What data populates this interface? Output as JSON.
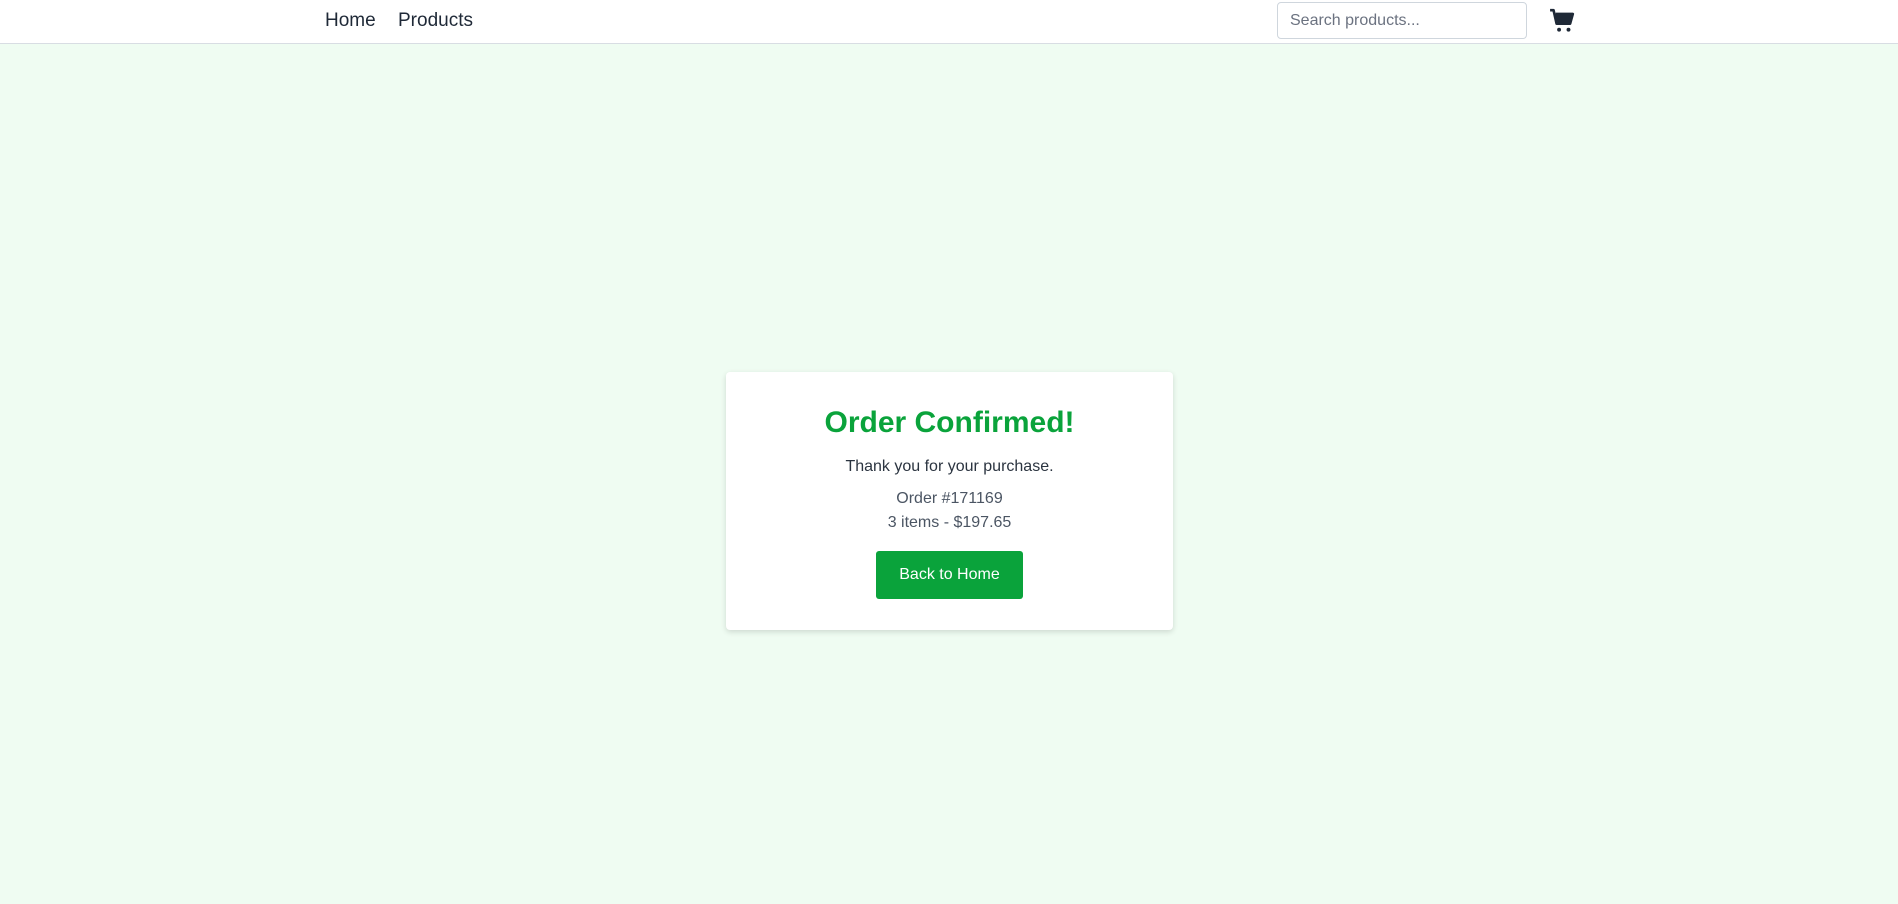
{
  "nav": {
    "links": [
      {
        "label": "Home"
      },
      {
        "label": "Products"
      }
    ],
    "search": {
      "placeholder": "Search products...",
      "value": ""
    },
    "cart_icon": "shopping-cart-icon"
  },
  "confirmation": {
    "title": "Order Confirmed!",
    "message": "Thank you for your purchase.",
    "order_number": "Order #171169",
    "summary": "3 items - $197.65",
    "button_label": "Back to Home"
  },
  "colors": {
    "background": "#effcf2",
    "accent": "#0aa33b",
    "text": "#1f2937"
  }
}
